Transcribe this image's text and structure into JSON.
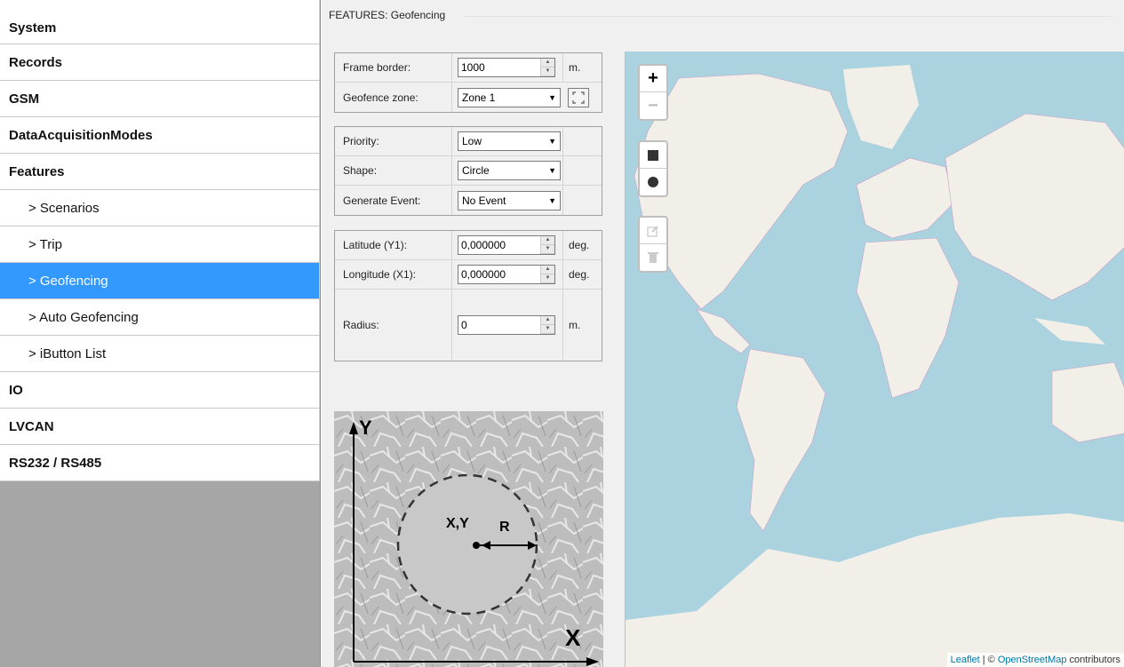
{
  "sidebar": {
    "items": [
      {
        "label": "System"
      },
      {
        "label": "Records"
      },
      {
        "label": "GSM"
      },
      {
        "label": "DataAcquisitionModes"
      },
      {
        "label": "Features"
      },
      {
        "label": "> Scenarios"
      },
      {
        "label": "> Trip"
      },
      {
        "label": "> Geofencing"
      },
      {
        "label": "> Auto Geofencing"
      },
      {
        "label": "> iButton List"
      },
      {
        "label": "IO"
      },
      {
        "label": "LVCAN"
      },
      {
        "label": "RS232 / RS485"
      }
    ]
  },
  "main": {
    "title": "FEATURES: Geofencing"
  },
  "form": {
    "frame_border": {
      "label": "Frame border:",
      "value": "1000",
      "unit": "m."
    },
    "geofence_zone": {
      "label": "Geofence zone:",
      "value": "Zone 1"
    },
    "priority": {
      "label": "Priority:",
      "value": "Low"
    },
    "shape": {
      "label": "Shape:",
      "value": "Circle"
    },
    "generate_event": {
      "label": "Generate Event:",
      "value": "No Event"
    },
    "latitude": {
      "label": "Latitude (Y1):",
      "value": "0,000000",
      "unit": "deg."
    },
    "longitude": {
      "label": "Longitude (X1):",
      "value": "0,000000",
      "unit": "deg."
    },
    "radius": {
      "label": "Radius:",
      "value": "0",
      "unit": "m."
    }
  },
  "illustration": {
    "y_label": "Y",
    "x_label": "X",
    "center_label": "X,Y",
    "radius_label": "R"
  },
  "map": {
    "zoom_in": "+",
    "zoom_out": "−",
    "attribution_leaflet": "Leaflet",
    "attribution_sep": " | © ",
    "attribution_osm": "OpenStreetMap",
    "attribution_tail": " contributors"
  },
  "icons": {
    "spinner": "spinner-icon",
    "dropdown": "chevron-down-icon",
    "zone_fit": "fit-bounds-icon",
    "rectangle": "rectangle-icon",
    "circle": "circle-icon",
    "edit": "edit-icon",
    "delete": "trash-icon"
  },
  "colors": {
    "active_nav": "#3399ff",
    "map_water": "#aad3df",
    "map_land": "#f2efe9"
  }
}
